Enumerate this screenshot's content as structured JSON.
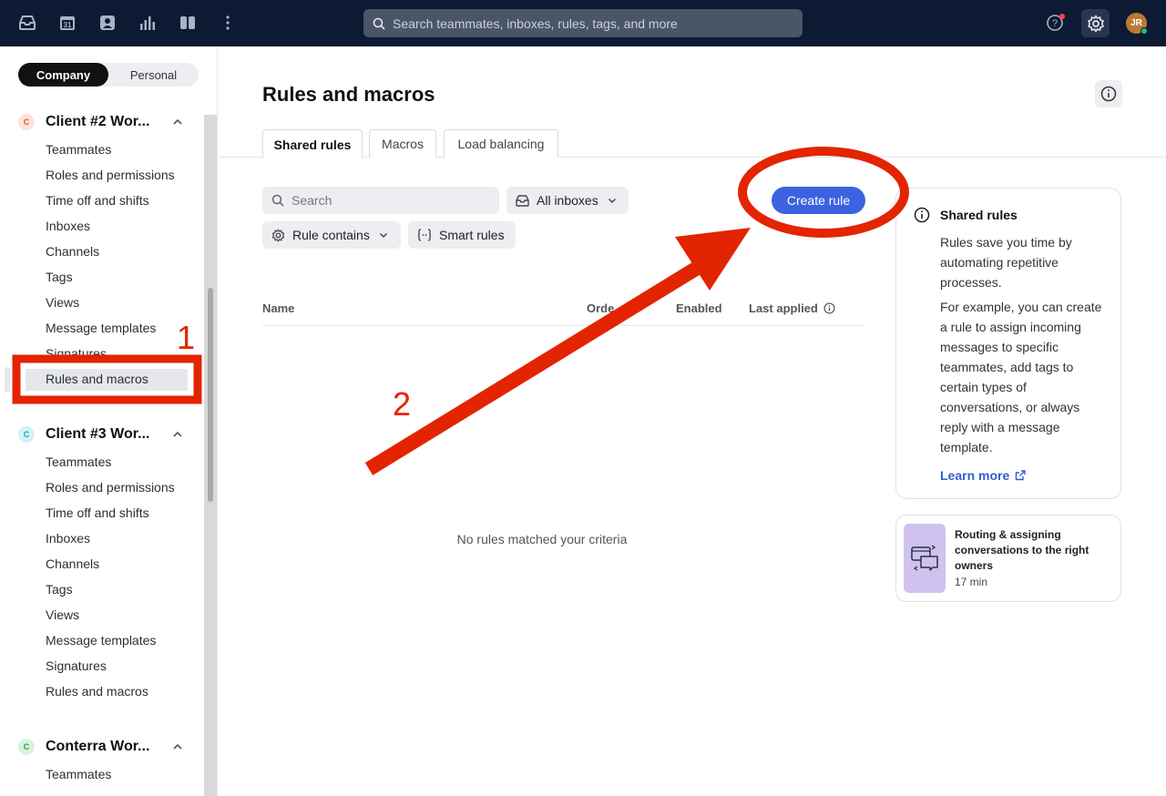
{
  "topbar": {
    "search_placeholder": "Search teammates, inboxes, rules, tags, and more",
    "avatar_initials": "JR"
  },
  "sidebar": {
    "toggle": {
      "company": "Company",
      "personal": "Personal"
    },
    "workspaces": [
      {
        "badge": "C",
        "title": "Client #2 Wor...",
        "items": [
          "Teammates",
          "Roles and permissions",
          "Time off and shifts",
          "Inboxes",
          "Channels",
          "Tags",
          "Views",
          "Message templates",
          "Signatures",
          "Rules and macros"
        ]
      },
      {
        "badge": "C",
        "title": "Client #3 Wor...",
        "items": [
          "Teammates",
          "Roles and permissions",
          "Time off and shifts",
          "Inboxes",
          "Channels",
          "Tags",
          "Views",
          "Message templates",
          "Signatures",
          "Rules and macros"
        ]
      },
      {
        "badge": "C",
        "title": "Conterra Wor...",
        "items": [
          "Teammates"
        ]
      }
    ]
  },
  "main": {
    "title": "Rules and macros",
    "tabs": [
      "Shared rules",
      "Macros",
      "Load balancing"
    ],
    "filters": {
      "search_placeholder": "Search",
      "inboxes": "All inboxes",
      "rule_contains": "Rule contains",
      "smart_rules": "Smart rules"
    },
    "create_button": "Create rule",
    "columns": [
      "Name",
      "Orde",
      "Enabled",
      "Last applied"
    ],
    "empty_message": "No rules matched your criteria",
    "info_card": {
      "title": "Shared rules",
      "para1": "Rules save you time by automating repetitive processes.",
      "para2": "For example, you can create a rule to assign incoming messages to specific teammates, add tags to certain types of conversations, or always reply with a message template.",
      "link": "Learn more"
    },
    "course_card": {
      "title": "Routing & assigning conversations to the right owners",
      "duration": "17 min"
    }
  },
  "annotations": {
    "step1": "1",
    "step2": "2",
    "color": "#e32400"
  },
  "colors": {
    "topbar": "#0c1a33",
    "accent": "#3b63e0"
  }
}
